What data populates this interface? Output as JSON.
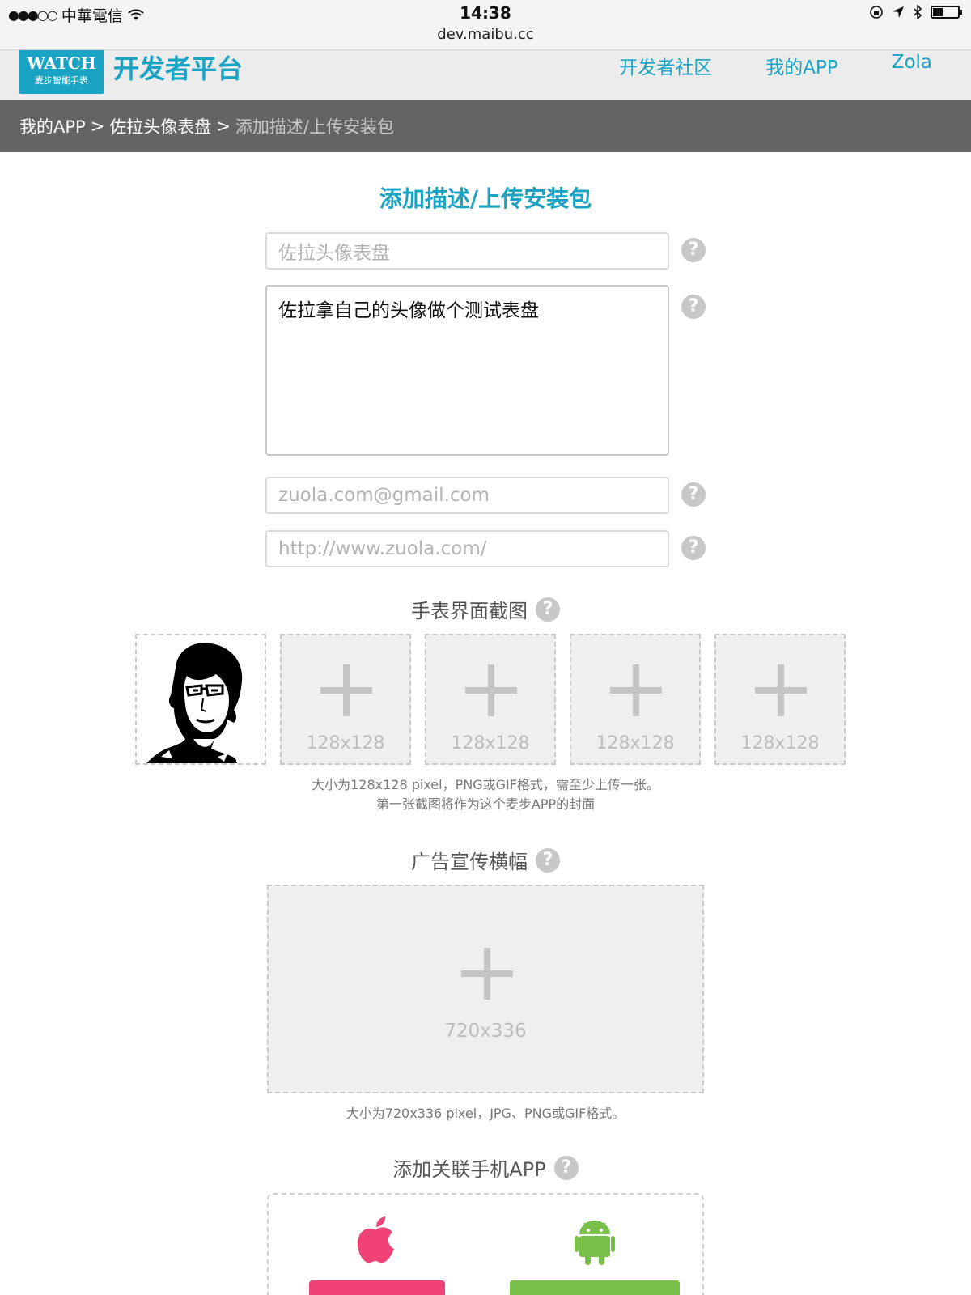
{
  "status_bar": {
    "signal": "●●●○○",
    "carrier": "中華電信",
    "time": "14:38",
    "url": "dev.maibu.cc",
    "battery_level": 0.4
  },
  "header": {
    "logo_text": "WATCH",
    "logo_subtext": "麦步智能手表",
    "platform_title": "开发者平台",
    "nav": {
      "community": "开发者社区",
      "my_app": "我的APP",
      "user": "Zola"
    }
  },
  "breadcrumb": {
    "item1": "我的APP",
    "item2": "佐拉头像表盘",
    "current": "添加描述/上传安装包",
    "separator": ">"
  },
  "form": {
    "heading": "添加描述/上传安装包",
    "name_placeholder": "佐拉头像表盘",
    "description_value": "佐拉拿自己的头像做个测试表盘",
    "email_placeholder": "zuola.com@gmail.com",
    "website_placeholder": "http://www.zuola.com/",
    "help_glyph": "?"
  },
  "screenshots": {
    "title": "手表界面截图",
    "slot_size": "128x128",
    "note_line1": "大小为128x128 pixel，PNG或GIF格式，需至少上传一张。",
    "note_line2": "第一张截图将作为这个麦步APP的封面"
  },
  "banner": {
    "title": "广告宣传横幅",
    "size": "720x336",
    "note": "大小为720x336 pixel，JPG、PNG或GIF格式。"
  },
  "phone_app": {
    "title": "添加关联手机APP"
  },
  "colors": {
    "accent": "#1aa3c3",
    "breadcrumb_bg": "#646464",
    "ios_button": "#ef4277",
    "android_button": "#79c04a"
  }
}
